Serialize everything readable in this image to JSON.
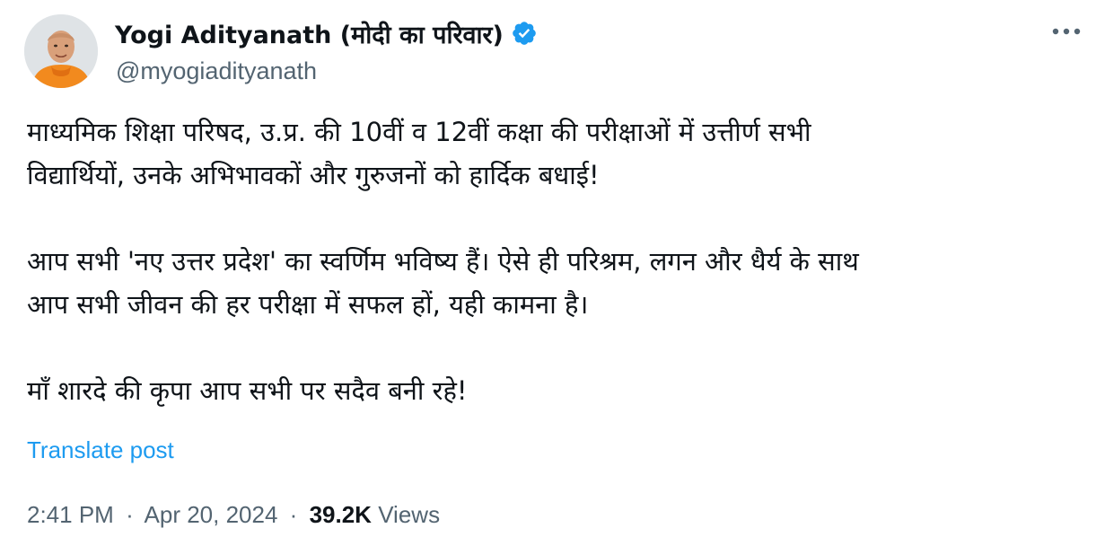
{
  "author": {
    "display_name": "Yogi Adityanath (मोदी का परिवार)",
    "handle": "@myogiadityanath"
  },
  "tweet": {
    "paragraphs": [
      [
        "माध्यमिक शिक्षा परिषद, उ.प्र. की 10वीं व 12वीं कक्षा की परीक्षाओं में उत्तीर्ण सभी",
        "विद्यार्थियों, उनके अभिभावकों और गुरुजनों को हार्दिक बधाई!"
      ],
      [
        "आप सभी 'नए उत्तर प्रदेश' का स्वर्णिम भविष्य हैं। ऐसे ही परिश्रम, लगन और धैर्य के साथ",
        "आप सभी जीवन की हर परीक्षा में सफल हों, यही कामना है।"
      ],
      [
        "माँ शारदे की कृपा आप सभी पर सदैव बनी रहे!"
      ]
    ],
    "translate_label": "Translate post"
  },
  "meta": {
    "time": "2:41 PM",
    "date": "Apr 20, 2024",
    "separator": "·",
    "views_count": "39.2K",
    "views_label": "Views"
  },
  "icons": {
    "verified": "verified-badge-icon",
    "more": "more-options-icon"
  },
  "colors": {
    "text": "#0f1419",
    "secondary": "#536471",
    "accent": "#1d9bf0"
  }
}
